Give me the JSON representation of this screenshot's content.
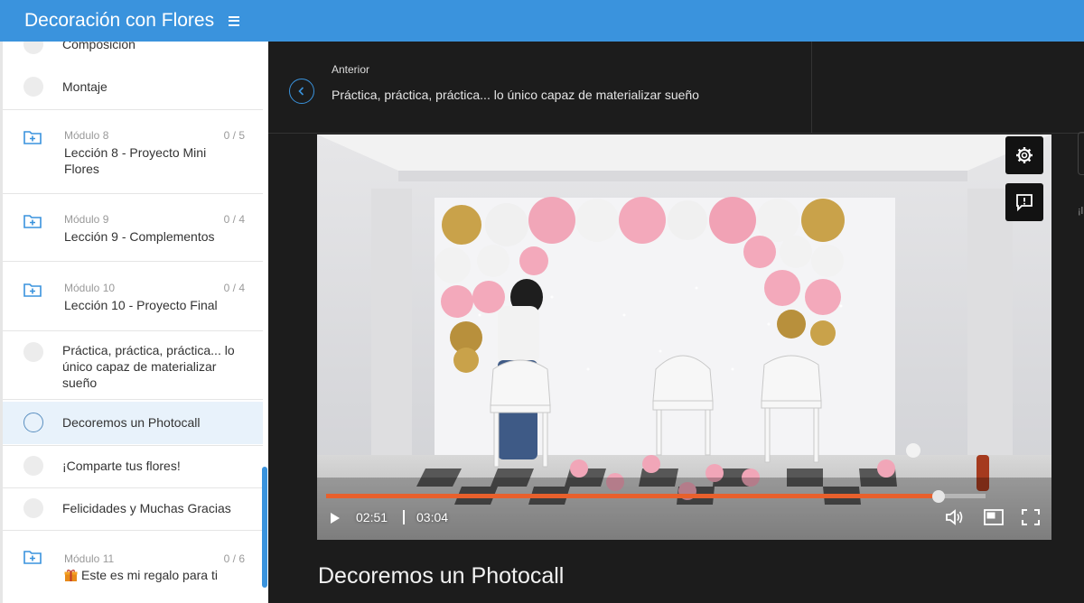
{
  "app": {
    "title": "Decoración con Flores"
  },
  "sidebar": {
    "top_partial": "Composición",
    "lessons_before": [
      {
        "label": "Montaje"
      }
    ],
    "modules": [
      {
        "label": "Módulo 8",
        "count": "0 / 5",
        "title": "Lección 8 - Proyecto Mini Flores"
      },
      {
        "label": "Módulo 9",
        "count": "0 / 4",
        "title": "Lección 9 - Complementos"
      },
      {
        "label": "Módulo 10",
        "count": "0 / 4",
        "title": "Lección 10 - Proyecto Final"
      }
    ],
    "lessons_after": [
      {
        "label": "Práctica, práctica, práctica... lo único capaz de materializar sueño"
      },
      {
        "label": "Decoremos un Photocall",
        "active": true
      },
      {
        "label": "¡Comparte tus flores!"
      },
      {
        "label": "Felicidades y Muchas Gracias"
      }
    ],
    "last_module": {
      "label": "Módulo 11",
      "count": "0 / 6",
      "title": "Este es mi regalo para ti",
      "icon": "gift-icon"
    }
  },
  "nav": {
    "prev_label": "Anterior",
    "prev_title": "Práctica, práctica, práctica... lo único capaz de materializar sueño"
  },
  "video": {
    "current_time": "02:51",
    "duration": "03:04",
    "progress": 0.929,
    "colors": {
      "progress": "#e8602c",
      "accent": "#3a93dd"
    }
  },
  "lesson": {
    "title": "Decoremos un Photocall"
  },
  "edge": {
    "partial_text": "¡l"
  }
}
